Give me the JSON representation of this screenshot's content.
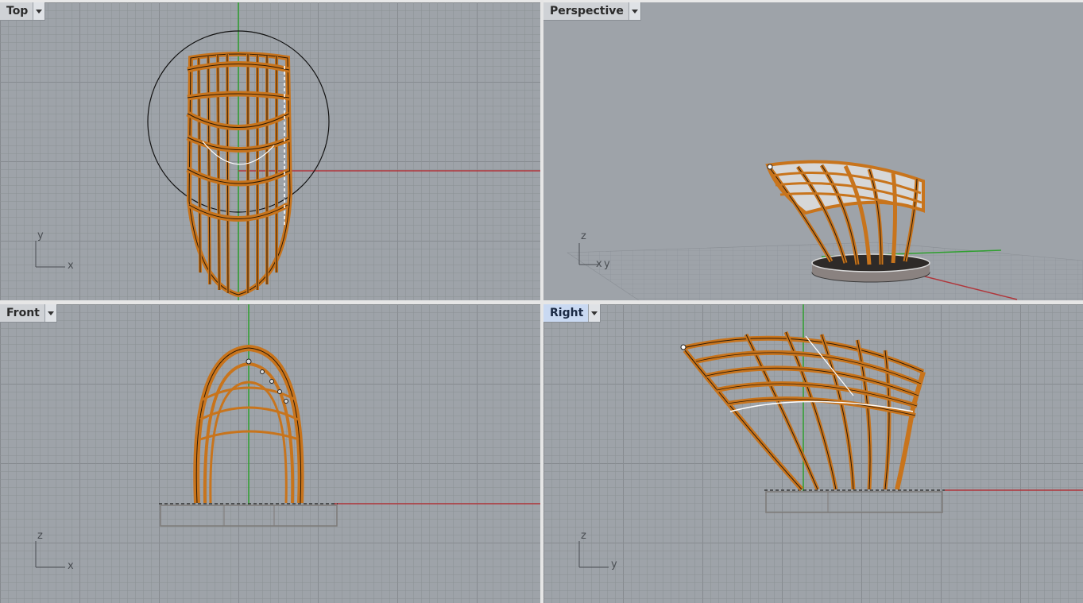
{
  "viewports": {
    "top": {
      "label": "Top",
      "axis_a": "x",
      "axis_b": "y"
    },
    "perspective": {
      "label": "Perspective",
      "axis_a": "x",
      "axis_b": "y",
      "axis_c": "z"
    },
    "front": {
      "label": "Front",
      "axis_a": "x",
      "axis_b": "z"
    },
    "right": {
      "label": "Right",
      "axis_a": "y",
      "axis_b": "z"
    }
  },
  "active_viewport": "right",
  "icons": {
    "viewport_menu": "dropdown-arrow-icon"
  },
  "colors": {
    "background": "#9ea3a9",
    "grid_minor": "#8c9196",
    "grid_major": "#787d82",
    "x_axis": "#b0353a",
    "y_axis": "#2fa02f",
    "rib_wood": "#c8741c",
    "rib_edge": "#2a1a08",
    "base": "#8a8280",
    "active_tab": "#c9d9f2"
  }
}
